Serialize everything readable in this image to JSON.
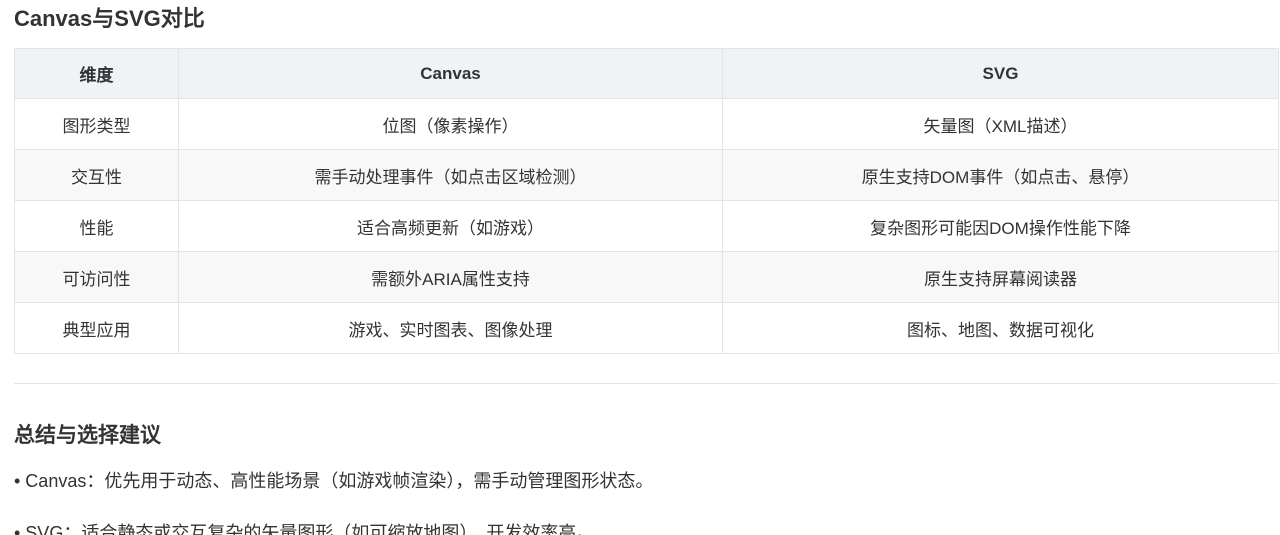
{
  "title": "Canvas与SVG对比",
  "table": {
    "headers": [
      "维度",
      "Canvas",
      "SVG"
    ],
    "rows": [
      [
        "图形类型",
        "位图（像素操作）",
        "矢量图（XML描述）"
      ],
      [
        "交互性",
        "需手动处理事件（如点击区域检测）",
        "原生支持DOM事件（如点击、悬停）"
      ],
      [
        "性能",
        "适合高频更新（如游戏）",
        "复杂图形可能因DOM操作性能下降"
      ],
      [
        "可访问性",
        "需额外ARIA属性支持",
        "原生支持屏幕阅读器"
      ],
      [
        "典型应用",
        "游戏、实时图表、图像处理",
        "图标、地图、数据可视化"
      ]
    ]
  },
  "summary": {
    "heading": "总结与选择建议",
    "bullets": [
      "• Canvas：优先用于动态、高性能场景（如游戏帧渲染），需手动管理图形状态。",
      "• SVG：适合静态或交互复杂的矢量图形（如可缩放地图），开发效率高。"
    ]
  }
}
